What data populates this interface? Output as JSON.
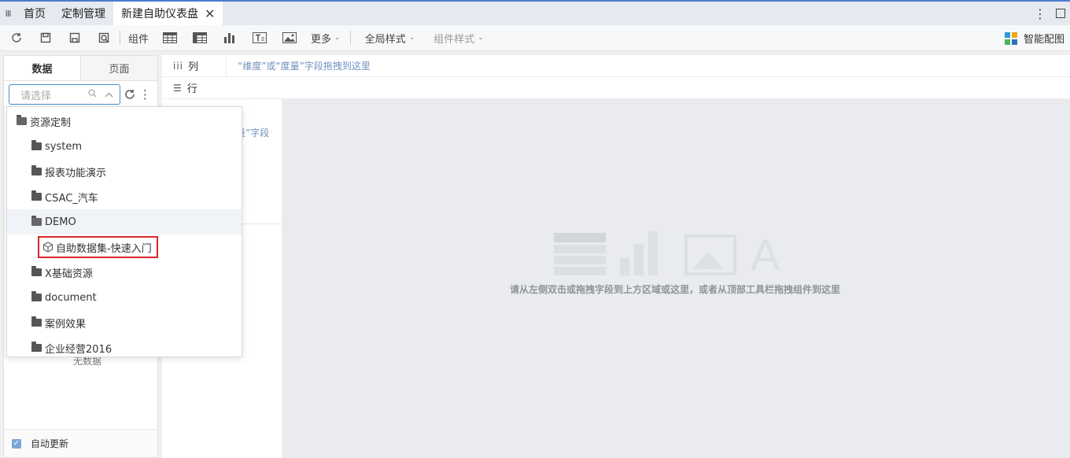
{
  "tabs": [
    {
      "label": "首页"
    },
    {
      "label": "定制管理"
    },
    {
      "label": "新建自助仪表盘",
      "active": true
    }
  ],
  "toolbar": {
    "component_label": "组件",
    "more_label": "更多",
    "global_style_label": "全局样式",
    "component_style_label": "组件样式",
    "smart_layout_label": "智能配图"
  },
  "left_panel": {
    "tab_data": "数据",
    "tab_page": "页面",
    "select_placeholder": "请选择",
    "no_data": "无数据",
    "auto_update_label": "自动更新",
    "auto_update_checked": true
  },
  "fields_area": {
    "columns_label": "列",
    "rows_label": "行",
    "columns_hint": "“维度”或“度量”字段拖拽到这里",
    "partial_hint": "量”字段"
  },
  "canvas": {
    "hint": "请从左侧双击或拖拽字段到上方区域或这里，或者从顶部工具栏拖拽组件到这里"
  },
  "tree": [
    {
      "label": "资源定制",
      "type": "folder-open",
      "level": 0
    },
    {
      "label": "system",
      "type": "folder",
      "level": 1
    },
    {
      "label": "报表功能演示",
      "type": "folder",
      "level": 1
    },
    {
      "label": "CSAC_汽车",
      "type": "folder",
      "level": 1
    },
    {
      "label": "DEMO",
      "type": "folder-open",
      "level": 1,
      "highlighted": true
    },
    {
      "label": "自助数据集-快速入门",
      "type": "dataset",
      "level": 2,
      "boxed": true
    },
    {
      "label": "X基础资源",
      "type": "folder",
      "level": 1
    },
    {
      "label": "document",
      "type": "folder",
      "level": 1
    },
    {
      "label": "案例效果",
      "type": "folder",
      "level": 1
    },
    {
      "label": "企业经营2016",
      "type": "folder",
      "level": 1
    }
  ],
  "colors": {
    "accent": "#4a8fd6",
    "highlight_box": "#d9262b",
    "hint_blue": "#6f91bd",
    "canvas_bg": "#e9ebee"
  },
  "icons": [
    "refresh-icon",
    "save-icon",
    "save-as-icon",
    "preview-icon",
    "table-icon",
    "crosstab-icon",
    "bar-chart-icon",
    "text-icon",
    "image-icon",
    "smart-layout-icon"
  ]
}
